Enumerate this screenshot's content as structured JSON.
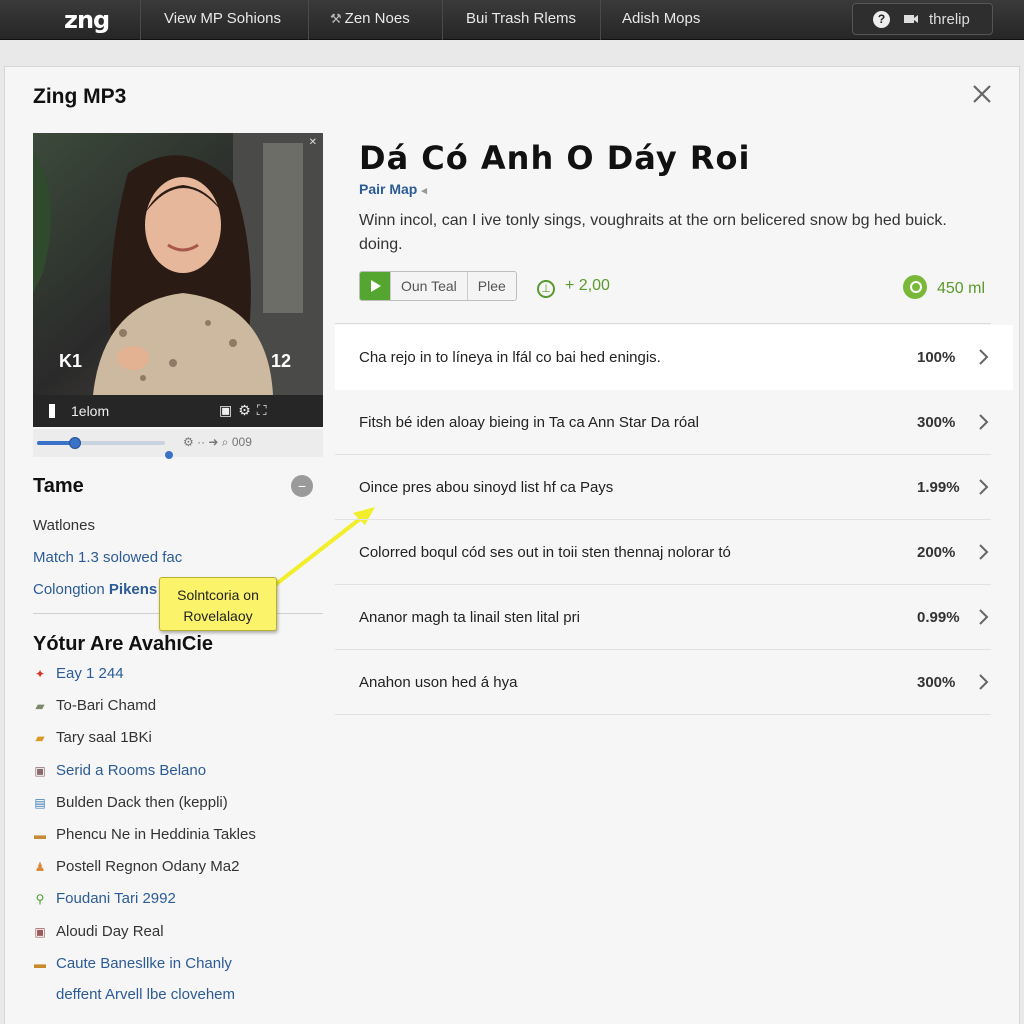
{
  "topbar": {
    "logo": "zng",
    "nav": [
      {
        "label": "View MP Sohions",
        "icon": ""
      },
      {
        "label": "Zen Noes",
        "icon": "⚒"
      },
      {
        "label": "Bui Trash Rlems",
        "icon": ""
      },
      {
        "label": "Adish Mops",
        "icon": ""
      }
    ],
    "help_label": "threlip"
  },
  "panel": {
    "title": "Zing MP3",
    "media": {
      "prev_label": "K1",
      "next_label": "12",
      "time_label": "1elom",
      "seek_extra": "⚙ ·· ➜ ⌕ 009"
    },
    "side": {
      "section_title": "Tame",
      "text_1": "Watlones",
      "link_1": "Match 1.3 solowed fac",
      "link_2_prefix": "Colongtion ",
      "link_2_bold": "Pikens",
      "related_title": "Yótur Are AvahıCie",
      "related": [
        {
          "icon": "✦",
          "icon_color": "#d9342b",
          "label": "Eay 1 244",
          "link": true
        },
        {
          "icon": "▰",
          "icon_color": "#7a8a6a",
          "label": "To-Bari Chamd",
          "link": false
        },
        {
          "icon": "▰",
          "icon_color": "#d99a2a",
          "label": "Tary saal 1BKi",
          "link": false
        },
        {
          "icon": "▣",
          "icon_color": "#8a6a6a",
          "label": "Serid a Rooms Belano",
          "link": true
        },
        {
          "icon": "▤",
          "icon_color": "#3a78b8",
          "label": "Bulden Dack then (keppli)",
          "link": false
        },
        {
          "icon": "▬",
          "icon_color": "#c98a3a",
          "label": "Phencu Ne in Heddinia Takles",
          "link": false
        },
        {
          "icon": "♟",
          "icon_color": "#d98a3a",
          "label": "Postell Regnon Odany Ma2",
          "link": false
        },
        {
          "icon": "⚲",
          "icon_color": "#4a9a2a",
          "label": "Foudani Tari 2992",
          "link": true
        },
        {
          "icon": "▣",
          "icon_color": "#9a5a5a",
          "label": "Aloudi Day Real",
          "link": false
        },
        {
          "icon": "▬",
          "icon_color": "#c98a2a",
          "label": "Caute Banesllke in Chanly",
          "link": true
        },
        {
          "icon": "",
          "icon_color": "#ffffff",
          "label": "deffent Arvell lbe clovehem",
          "link": true
        }
      ]
    },
    "tooltip": {
      "line1": "Solntcoria on",
      "line2": "Rovelalaoy"
    },
    "song": {
      "title": "Dá  Có  Anh  O  Dáy Roi",
      "artist": "Pair Map",
      "description": "Winn incol, can I ive tonly sings, voughraits at the orn belicered snow bg hed buick. doing.",
      "buttons": [
        "Oun Teal",
        "Plee"
      ],
      "plus_stat": "+ 2,00",
      "count_stat": "450 ml"
    },
    "tracks": [
      {
        "title": "Cha rejo in to líneya in lfál co bai hed eningis.",
        "value": "100%"
      },
      {
        "title": "Fitsh bé iden aloay bieing in Ta ca Ann Star Da róal",
        "value": "300%"
      },
      {
        "title": "Oince pres abou sinoyd list hf ca Pays",
        "value": "1.99%"
      },
      {
        "title": "Colorred boqul cód ses out in toii sten thennaj nolorar tó",
        "value": "200%"
      },
      {
        "title": "Ananor magh ta linail sten lital pri",
        "value": "0.99%"
      },
      {
        "title": "Anahon uson hed á hya",
        "value": "300%"
      }
    ]
  }
}
